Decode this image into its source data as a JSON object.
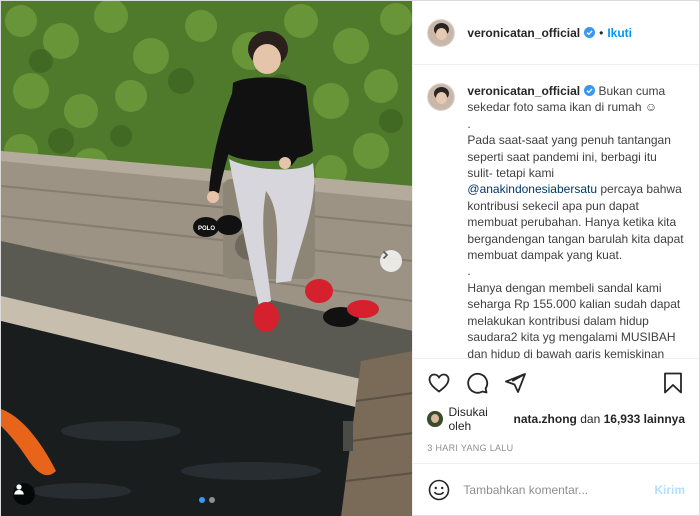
{
  "post": {
    "username": "veronicatan_official",
    "follow_label": "Ikuti",
    "separator": "•",
    "caption_lines": [
      "Bukan cuma sekedar foto sama ikan di rumah ☺",
      ".",
      "Pada saat-saat yang penuh tantangan seperti saat pandemi ini, berbagi itu sulit- tetapi kami",
      "@anakindonesiabersatu",
      "percaya bahwa kontribusi sekecil apa pun dapat membuat perubahan. Hanya ketika kita bergandengan tangan barulah kita dapat membuat dampak yang kuat.",
      ".",
      "Hanya dengan membeli sandal kami seharga Rp 155.000 kalian sudah dapat melakukan kontribusi dalam hidup saudara2 kita yg mengalami MUSIBAH dan hidup di bawah garis kemiskinan"
    ],
    "likes": {
      "prefix": "Disukai oleh",
      "user": "nata.zhong",
      "joiner": "dan",
      "count": "16,933",
      "suffix": "lainnya"
    },
    "timestamp": "3 HARI YANG LALU",
    "comment_placeholder": "Tambahkan komentar...",
    "post_label": "Kirim"
  },
  "carousel": {
    "total": 2,
    "active": 1
  },
  "colors": {
    "accent": "#0095f6",
    "verified": "#3897f0",
    "post_disabled": "#b2dffc"
  },
  "icons": [
    "user-tag-icon",
    "next-arrow-icon",
    "verified-badge-icon",
    "heart-icon",
    "comment-icon",
    "share-icon",
    "bookmark-icon",
    "emoji-icon"
  ]
}
